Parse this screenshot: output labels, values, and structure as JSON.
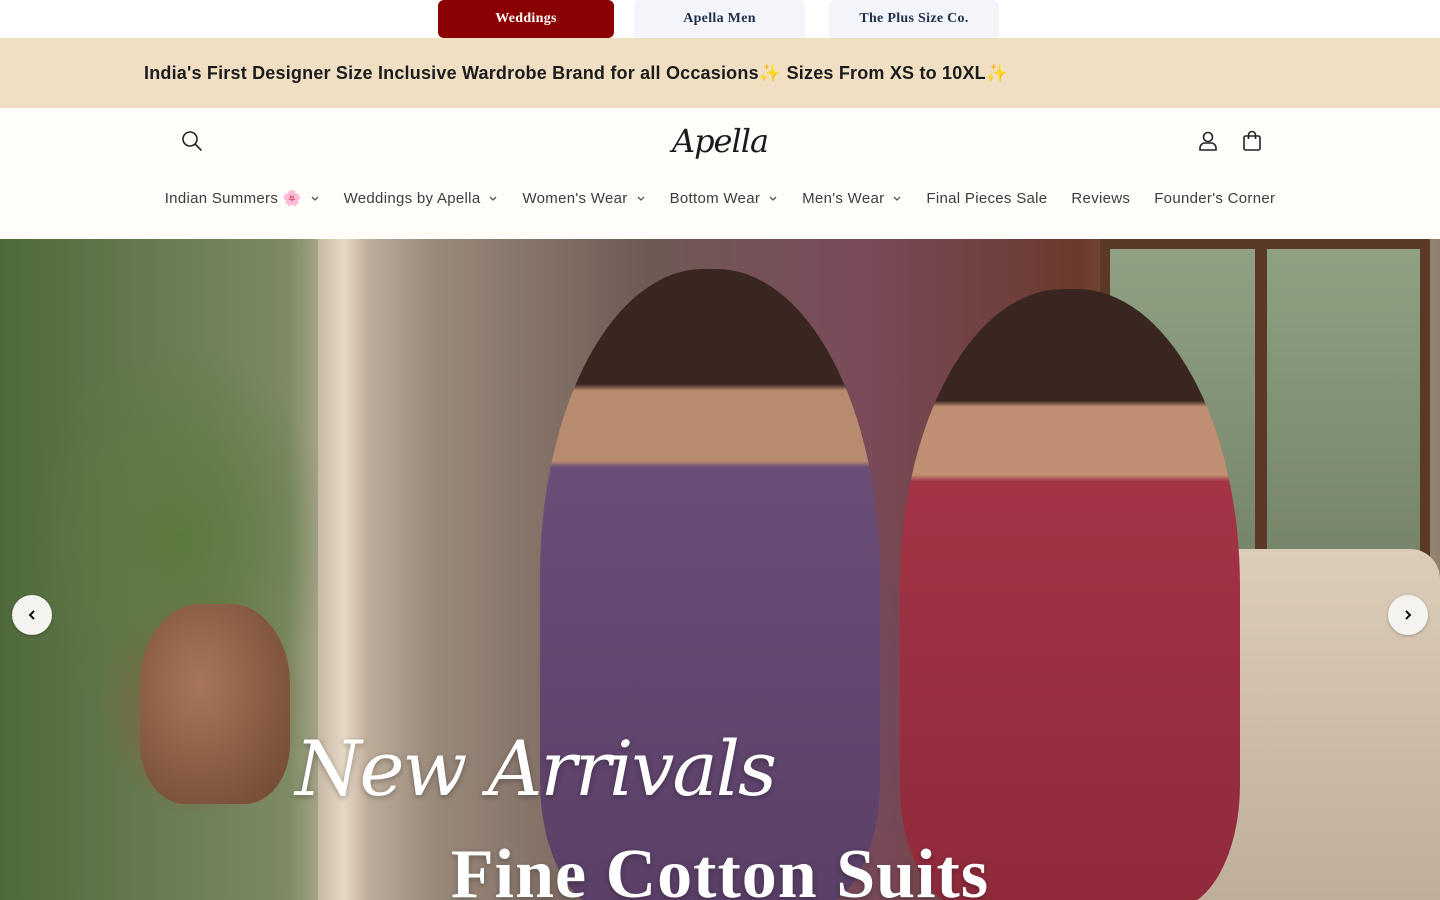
{
  "store_switcher": {
    "tabs": [
      {
        "label": "Weddings",
        "active": true
      },
      {
        "label": "Apella Men",
        "active": false
      },
      {
        "label": "The Plus Size Co.",
        "active": false
      }
    ]
  },
  "announcement": {
    "text": "India's First Designer Size Inclusive Wardrobe Brand for all Occasions✨ Sizes From XS to 10XL✨"
  },
  "header": {
    "logo": "Apella",
    "icons": {
      "search": "search-icon",
      "account": "user-icon",
      "cart": "bag-icon"
    }
  },
  "nav": {
    "items": [
      {
        "label": "Indian Summers 🌸",
        "dropdown": true
      },
      {
        "label": "Weddings by Apella",
        "dropdown": true
      },
      {
        "label": "Women's Wear",
        "dropdown": true
      },
      {
        "label": "Bottom Wear",
        "dropdown": true
      },
      {
        "label": "Men's Wear",
        "dropdown": true
      },
      {
        "label": "Final Pieces Sale",
        "dropdown": false
      },
      {
        "label": "Reviews",
        "dropdown": false
      },
      {
        "label": "Founder's Corner",
        "dropdown": false
      }
    ]
  },
  "hero": {
    "script_text": "New Arrivals",
    "title": "Fine Cotton Suits",
    "prev_icon": "chevron-left-icon",
    "next_icon": "chevron-right-icon"
  },
  "colors": {
    "active_tab": "#8b0000",
    "announcement_bg": "#f0dfc3",
    "page_bg": "#fffdf9"
  }
}
